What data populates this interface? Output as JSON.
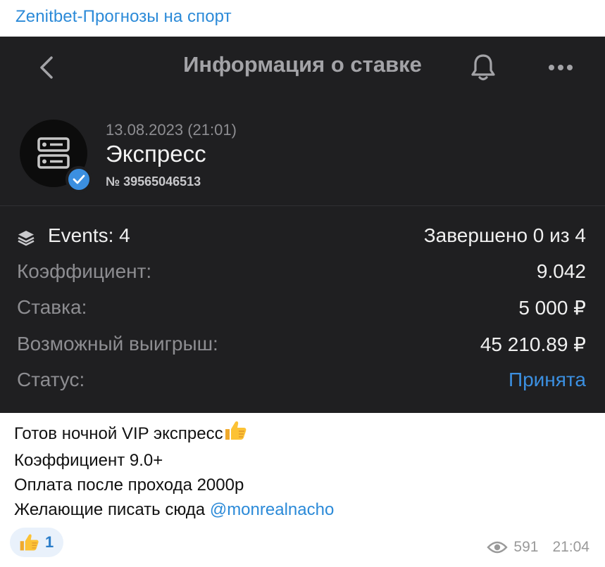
{
  "channel": {
    "name": "Zenitbet-Прогнозы на спорт"
  },
  "screenshot": {
    "appbar": {
      "title": "Информация о ставке"
    },
    "bet": {
      "datetime": "13.08.2023 (21:01)",
      "type": "Экспресс",
      "number": "№ 39565046513"
    },
    "rows": {
      "events_label": "Events: 4",
      "events_value": "Завершено 0 из 4",
      "coef_label": "Коэффициент:",
      "coef_value": "9.042",
      "stake_label": "Ставка:",
      "stake_value": "5 000 ₽",
      "win_label": "Возможный выигрыш:",
      "win_value": "45 210.89 ₽",
      "status_label": "Статус:",
      "status_value": "Принята"
    },
    "colors": {
      "background": "#1f1f21",
      "accent": "#3b8fe0",
      "muted_text": "#8d8d91",
      "primary_text": "#f0f0f0"
    }
  },
  "caption": {
    "line1": "Готов ночной VIP экспресс",
    "line1_emoji": "thumbs-up",
    "line2": "Коэффициент 9.0+",
    "line3": "Оплата после прохода 2000р",
    "line4_prefix": "Желающие писать сюда ",
    "line4_mention": "@monrealnacho"
  },
  "reactions": [
    {
      "emoji": "thumbs-up",
      "count": "1"
    }
  ],
  "footer": {
    "views": "591",
    "time": "21:04"
  }
}
